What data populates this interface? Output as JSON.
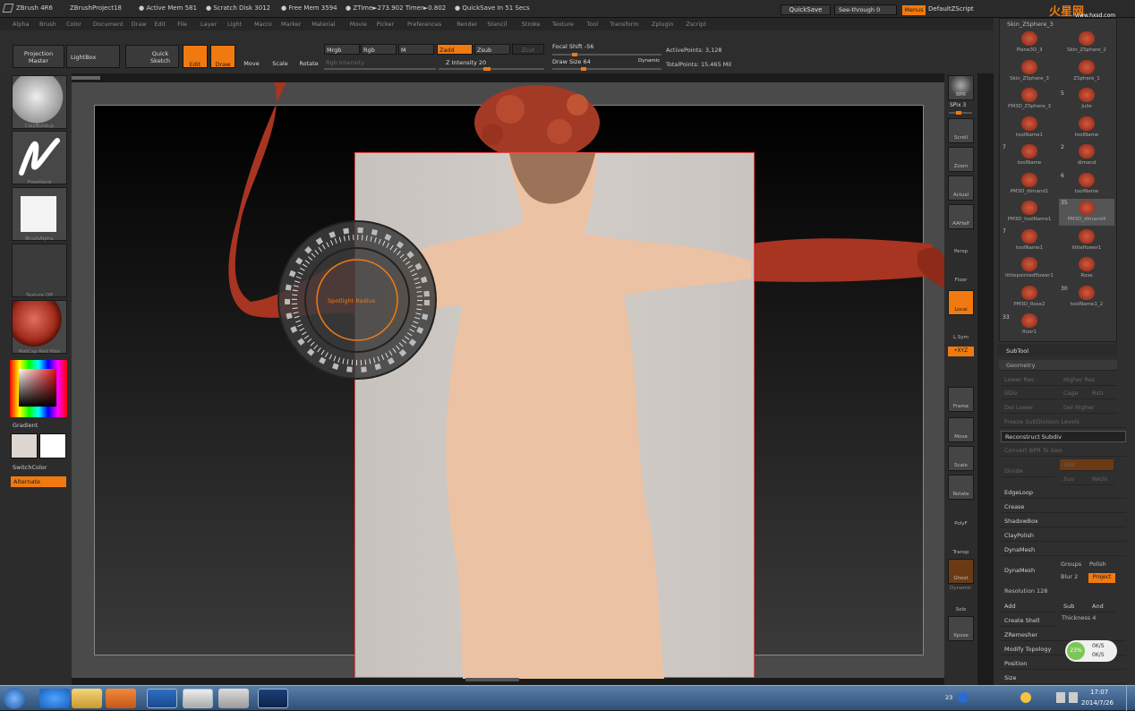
{
  "title_bar": {
    "app": "ZBrush 4R6",
    "project": "ZBrushProject18",
    "active_mem": "● Active Mem 581",
    "scratch_disk": "● Scratch Disk 3012",
    "free_mem": "● Free Mem 3594",
    "ztime": "● ZTime►273.902 Timer►0.802",
    "quicksave_info": "● QuickSave In 51 Secs",
    "quicksave_btn": "QuickSave",
    "see_through": "See-through  0",
    "menus": "Menus",
    "default_script": "DefaultZScript",
    "watermark": "火星网",
    "watermark_url": "www.hxsd.com"
  },
  "menu": [
    "Alpha",
    "Brush",
    "Color",
    "Document",
    "Draw",
    "Edit",
    "File",
    "Layer",
    "Light",
    "Macro",
    "Marker",
    "Material",
    "Movie",
    "Picker",
    "Preferences",
    "Render",
    "Stencil",
    "Stroke",
    "Texture",
    "Tool",
    "Transform",
    "Zplugin",
    "Zscript"
  ],
  "toolbar": {
    "projection_master": "Projection\nMaster",
    "lightbox": "LightBox",
    "quick_sketch": "Quick\nSketch",
    "edit": "Edit",
    "draw": "Draw",
    "move": "Move",
    "scale": "Scale",
    "rotate": "Rotate",
    "mrgb": "Mrgb",
    "rgb": "Rgb",
    "m": "M",
    "zadd": "Zadd",
    "zsub": "Zsub",
    "zcut": "Zcut",
    "rgb_intensity": "Rgb Intensity",
    "z_intensity": "Z Intensity 20",
    "focal_shift": "Focal Shift -56",
    "draw_size": "Draw Size 64",
    "dynamic": "Dynamic",
    "active_points": "ActivePoints: 3,128",
    "total_points": "TotalPoints: 15.465 Mil"
  },
  "left_shelf": {
    "brush": "ClayBuildup",
    "stroke": "FreeHand",
    "alpha": "BrushAlpha",
    "texture": "Texture Off",
    "material": "MatCap Red Wax",
    "gradient": "Gradient",
    "switch_color": "SwitchColor",
    "alternate": "Alternate"
  },
  "radial_menu": {
    "label": "Spotlight Radius"
  },
  "right_shelf": {
    "bpr": "BPR",
    "spix": "SPix 3",
    "scroll": "Scroll",
    "zoom": "Zoom",
    "actual": "Actual",
    "aahalf": "AAHalf",
    "persp": "Persp",
    "floor": "Floor",
    "local": "Local",
    "lsym": "L.Sym",
    "xyz": "•XYZ",
    "frame": "Frame",
    "move": "Move",
    "scale": "Scale",
    "rotate": "Rotate",
    "polyf": "PolyF",
    "transp": "Transp",
    "ghost": "Ghost",
    "dynamic": "Dynamic",
    "solo": "Solo",
    "xpose": "Xpose"
  },
  "tool_palette": {
    "header": "Skin_ZSphere_3",
    "items": [
      {
        "label": "Plane3D_3"
      },
      {
        "label": "Skin_ZSphere_2"
      },
      {
        "label": "Skin_ZSphere_3"
      },
      {
        "label": "ZSphere_1"
      },
      {
        "label": "PM3D_ZSphere_3"
      },
      {
        "label": "Julie"
      },
      {
        "label": "toolName1"
      },
      {
        "label": "toolName"
      },
      {
        "label": "toolName"
      },
      {
        "label": "dimand"
      },
      {
        "label": "PM3D_dimand1"
      },
      {
        "label": "toolName"
      },
      {
        "label": "PM3D_toolName1"
      },
      {
        "label": "PM3D_dimand4"
      },
      {
        "label": "toolName1"
      },
      {
        "label": "littleflower1"
      },
      {
        "label": "littlepointedflower1"
      },
      {
        "label": "Rose"
      },
      {
        "label": "PM3D_Rose2"
      },
      {
        "label": "toolName1_2"
      },
      {
        "label": "floor1"
      }
    ],
    "numbers": [
      "5",
      "7",
      "2",
      "6",
      "35",
      "7",
      "30",
      "33"
    ]
  },
  "subtool": {
    "title": "SubTool",
    "geometry": "Geometry",
    "lower_res": "Lower Res",
    "higher_res": "Higher Res",
    "sdiv": "SDiv",
    "cage": "Cage",
    "rstr": "Rstr",
    "del_lower": "Del Lower",
    "del_higher": "Del Higher",
    "freeze": "Freeze SubDivision Levels",
    "reconstruct": "Reconstruct Subdiv",
    "convert_bpr": "Convert BPR To Geo",
    "divide": "Divide",
    "smt": "Smt",
    "suv": "Suv",
    "reuv": "ReUV",
    "edgeloop": "EdgeLoop",
    "crease": "Crease",
    "shadowbox": "ShadowBox",
    "claypolish": "ClayPolish",
    "dynamesh_head": "DynaMesh",
    "dynamesh": "DynaMesh",
    "groups": "Groups",
    "polish": "Polish",
    "blur": "Blur 2",
    "project": "Project",
    "resolution": "Resolution 128",
    "add": "Add",
    "sub": "Sub",
    "and": "And",
    "create_shell": "Create Shell",
    "thickness": "Thickness 4",
    "zremesher": "ZRemesher",
    "modify_topology": "Modify Topology",
    "position": "Position",
    "size": "Size"
  },
  "net_widget": {
    "percent": "23%",
    "up": "0K/S",
    "down": "0K/S"
  },
  "taskbar": {
    "time": "17:07",
    "date": "2014/7/26",
    "tray_num": "23"
  },
  "colors": {
    "accent": "#f07a10",
    "clay": "#b03a26",
    "skin": "#e9c1a9",
    "taskbar": "#3c5f8a"
  }
}
